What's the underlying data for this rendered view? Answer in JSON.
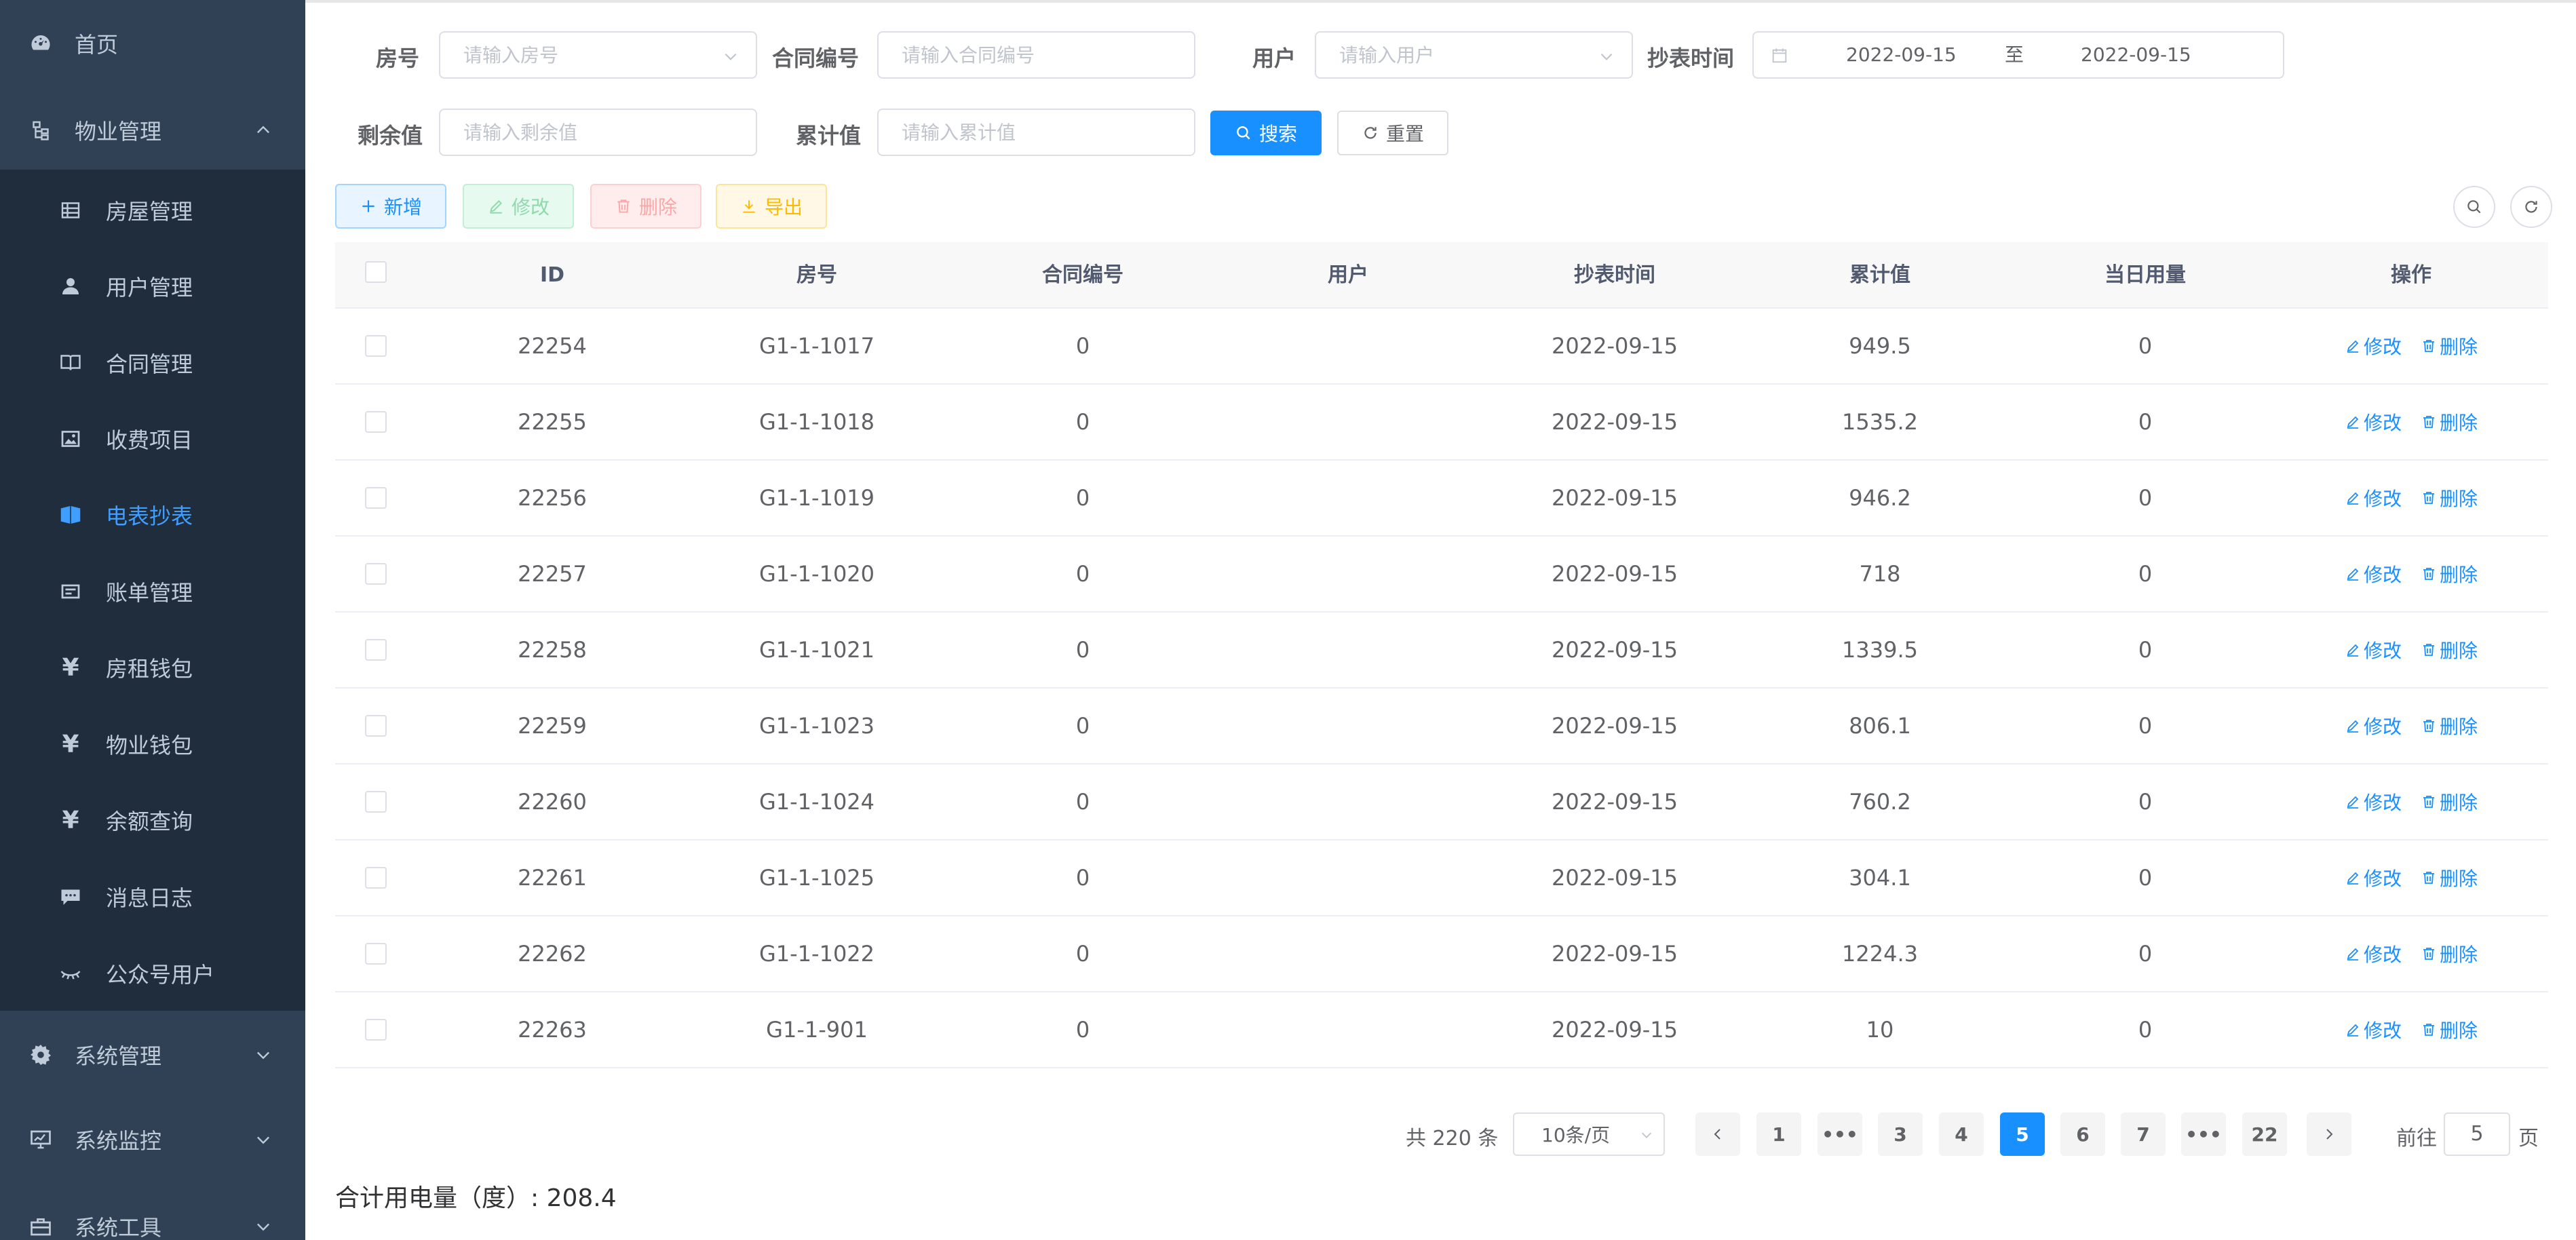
{
  "sidebar": {
    "items": [
      {
        "label": "首页",
        "icon": "dashboard-icon"
      },
      {
        "label": "物业管理",
        "icon": "tree-icon",
        "expanded": true
      },
      {
        "label": "房屋管理",
        "icon": "table-icon"
      },
      {
        "label": "用户管理",
        "icon": "user-icon"
      },
      {
        "label": "合同管理",
        "icon": "book-icon"
      },
      {
        "label": "收费项目",
        "icon": "image-icon"
      },
      {
        "label": "电表抄表",
        "icon": "meter-icon",
        "active": true
      },
      {
        "label": "账单管理",
        "icon": "bill-icon"
      },
      {
        "label": "房租钱包",
        "icon": "yen-icon"
      },
      {
        "label": "物业钱包",
        "icon": "yen-icon"
      },
      {
        "label": "余额查询",
        "icon": "yen-icon"
      },
      {
        "label": "消息日志",
        "icon": "message-icon"
      },
      {
        "label": "公众号用户",
        "icon": "eye-closed-icon"
      },
      {
        "label": "系统管理",
        "icon": "gear-icon"
      },
      {
        "label": "系统监控",
        "icon": "monitor-icon"
      },
      {
        "label": "系统工具",
        "icon": "toolbox-icon"
      }
    ]
  },
  "filters": {
    "room_label": "房号",
    "room_placeholder": "请输入房号",
    "contract_label": "合同编号",
    "contract_placeholder": "请输入合同编号",
    "user_label": "用户",
    "user_placeholder": "请输入用户",
    "time_label": "抄表时间",
    "date_start": "2022-09-15",
    "date_sep": "至",
    "date_end": "2022-09-15",
    "remain_label": "剩余值",
    "remain_placeholder": "请输入剩余值",
    "cumulative_label": "累计值",
    "cumulative_placeholder": "请输入累计值",
    "search_button": "搜索",
    "reset_button": "重置"
  },
  "toolbar": {
    "add_label": "新增",
    "edit_label": "修改",
    "delete_label": "删除",
    "export_label": "导出"
  },
  "table": {
    "columns": [
      "ID",
      "房号",
      "合同编号",
      "用户",
      "抄表时间",
      "累计值",
      "当日用量",
      "操作"
    ],
    "edit_label": "修改",
    "delete_label": "删除",
    "rows": [
      {
        "id": "22254",
        "room": "G1-1-1017",
        "contract": "0",
        "user": "",
        "time": "2022-09-15",
        "cumulative": "949.5",
        "daily": "0"
      },
      {
        "id": "22255",
        "room": "G1-1-1018",
        "contract": "0",
        "user": "",
        "time": "2022-09-15",
        "cumulative": "1535.2",
        "daily": "0"
      },
      {
        "id": "22256",
        "room": "G1-1-1019",
        "contract": "0",
        "user": "",
        "time": "2022-09-15",
        "cumulative": "946.2",
        "daily": "0"
      },
      {
        "id": "22257",
        "room": "G1-1-1020",
        "contract": "0",
        "user": "",
        "time": "2022-09-15",
        "cumulative": "718",
        "daily": "0"
      },
      {
        "id": "22258",
        "room": "G1-1-1021",
        "contract": "0",
        "user": "",
        "time": "2022-09-15",
        "cumulative": "1339.5",
        "daily": "0"
      },
      {
        "id": "22259",
        "room": "G1-1-1023",
        "contract": "0",
        "user": "",
        "time": "2022-09-15",
        "cumulative": "806.1",
        "daily": "0"
      },
      {
        "id": "22260",
        "room": "G1-1-1024",
        "contract": "0",
        "user": "",
        "time": "2022-09-15",
        "cumulative": "760.2",
        "daily": "0"
      },
      {
        "id": "22261",
        "room": "G1-1-1025",
        "contract": "0",
        "user": "",
        "time": "2022-09-15",
        "cumulative": "304.1",
        "daily": "0"
      },
      {
        "id": "22262",
        "room": "G1-1-1022",
        "contract": "0",
        "user": "",
        "time": "2022-09-15",
        "cumulative": "1224.3",
        "daily": "0"
      },
      {
        "id": "22263",
        "room": "G1-1-901",
        "contract": "0",
        "user": "",
        "time": "2022-09-15",
        "cumulative": "10",
        "daily": "0"
      }
    ]
  },
  "pagination": {
    "total_text": "共 220 条",
    "page_size": "10条/页",
    "pages": [
      "1",
      "•••",
      "3",
      "4",
      "5",
      "6",
      "7",
      "•••",
      "22"
    ],
    "current": "5",
    "goto_label": "前往",
    "goto_value": "5",
    "page_suffix": "页"
  },
  "summary": {
    "total_text": "合计用电量（度）: 208.4"
  },
  "colors": {
    "sidebar_bg": "#304156",
    "submenu_bg": "#1f2d3d",
    "primary": "#1890ff",
    "menu_text": "#bfcbd9"
  }
}
